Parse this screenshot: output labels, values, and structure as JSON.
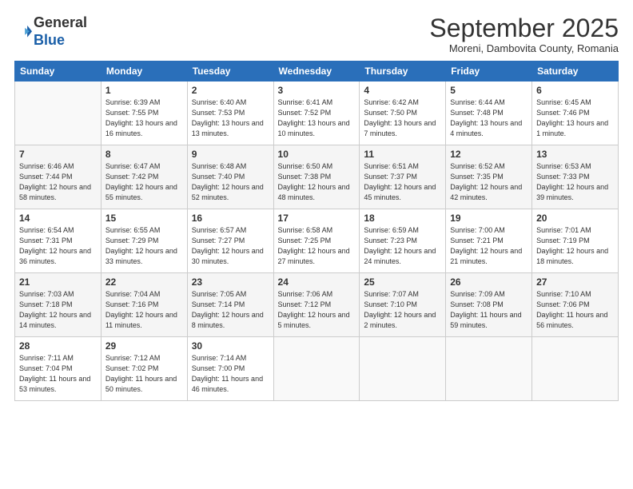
{
  "header": {
    "logo_line1": "General",
    "logo_line2": "Blue",
    "month": "September 2025",
    "location": "Moreni, Dambovita County, Romania"
  },
  "weekdays": [
    "Sunday",
    "Monday",
    "Tuesday",
    "Wednesday",
    "Thursday",
    "Friday",
    "Saturday"
  ],
  "weeks": [
    [
      {
        "day": "",
        "sunrise": "",
        "sunset": "",
        "daylight": ""
      },
      {
        "day": "1",
        "sunrise": "Sunrise: 6:39 AM",
        "sunset": "Sunset: 7:55 PM",
        "daylight": "Daylight: 13 hours and 16 minutes."
      },
      {
        "day": "2",
        "sunrise": "Sunrise: 6:40 AM",
        "sunset": "Sunset: 7:53 PM",
        "daylight": "Daylight: 13 hours and 13 minutes."
      },
      {
        "day": "3",
        "sunrise": "Sunrise: 6:41 AM",
        "sunset": "Sunset: 7:52 PM",
        "daylight": "Daylight: 13 hours and 10 minutes."
      },
      {
        "day": "4",
        "sunrise": "Sunrise: 6:42 AM",
        "sunset": "Sunset: 7:50 PM",
        "daylight": "Daylight: 13 hours and 7 minutes."
      },
      {
        "day": "5",
        "sunrise": "Sunrise: 6:44 AM",
        "sunset": "Sunset: 7:48 PM",
        "daylight": "Daylight: 13 hours and 4 minutes."
      },
      {
        "day": "6",
        "sunrise": "Sunrise: 6:45 AM",
        "sunset": "Sunset: 7:46 PM",
        "daylight": "Daylight: 13 hours and 1 minute."
      }
    ],
    [
      {
        "day": "7",
        "sunrise": "Sunrise: 6:46 AM",
        "sunset": "Sunset: 7:44 PM",
        "daylight": "Daylight: 12 hours and 58 minutes."
      },
      {
        "day": "8",
        "sunrise": "Sunrise: 6:47 AM",
        "sunset": "Sunset: 7:42 PM",
        "daylight": "Daylight: 12 hours and 55 minutes."
      },
      {
        "day": "9",
        "sunrise": "Sunrise: 6:48 AM",
        "sunset": "Sunset: 7:40 PM",
        "daylight": "Daylight: 12 hours and 52 minutes."
      },
      {
        "day": "10",
        "sunrise": "Sunrise: 6:50 AM",
        "sunset": "Sunset: 7:38 PM",
        "daylight": "Daylight: 12 hours and 48 minutes."
      },
      {
        "day": "11",
        "sunrise": "Sunrise: 6:51 AM",
        "sunset": "Sunset: 7:37 PM",
        "daylight": "Daylight: 12 hours and 45 minutes."
      },
      {
        "day": "12",
        "sunrise": "Sunrise: 6:52 AM",
        "sunset": "Sunset: 7:35 PM",
        "daylight": "Daylight: 12 hours and 42 minutes."
      },
      {
        "day": "13",
        "sunrise": "Sunrise: 6:53 AM",
        "sunset": "Sunset: 7:33 PM",
        "daylight": "Daylight: 12 hours and 39 minutes."
      }
    ],
    [
      {
        "day": "14",
        "sunrise": "Sunrise: 6:54 AM",
        "sunset": "Sunset: 7:31 PM",
        "daylight": "Daylight: 12 hours and 36 minutes."
      },
      {
        "day": "15",
        "sunrise": "Sunrise: 6:55 AM",
        "sunset": "Sunset: 7:29 PM",
        "daylight": "Daylight: 12 hours and 33 minutes."
      },
      {
        "day": "16",
        "sunrise": "Sunrise: 6:57 AM",
        "sunset": "Sunset: 7:27 PM",
        "daylight": "Daylight: 12 hours and 30 minutes."
      },
      {
        "day": "17",
        "sunrise": "Sunrise: 6:58 AM",
        "sunset": "Sunset: 7:25 PM",
        "daylight": "Daylight: 12 hours and 27 minutes."
      },
      {
        "day": "18",
        "sunrise": "Sunrise: 6:59 AM",
        "sunset": "Sunset: 7:23 PM",
        "daylight": "Daylight: 12 hours and 24 minutes."
      },
      {
        "day": "19",
        "sunrise": "Sunrise: 7:00 AM",
        "sunset": "Sunset: 7:21 PM",
        "daylight": "Daylight: 12 hours and 21 minutes."
      },
      {
        "day": "20",
        "sunrise": "Sunrise: 7:01 AM",
        "sunset": "Sunset: 7:19 PM",
        "daylight": "Daylight: 12 hours and 18 minutes."
      }
    ],
    [
      {
        "day": "21",
        "sunrise": "Sunrise: 7:03 AM",
        "sunset": "Sunset: 7:18 PM",
        "daylight": "Daylight: 12 hours and 14 minutes."
      },
      {
        "day": "22",
        "sunrise": "Sunrise: 7:04 AM",
        "sunset": "Sunset: 7:16 PM",
        "daylight": "Daylight: 12 hours and 11 minutes."
      },
      {
        "day": "23",
        "sunrise": "Sunrise: 7:05 AM",
        "sunset": "Sunset: 7:14 PM",
        "daylight": "Daylight: 12 hours and 8 minutes."
      },
      {
        "day": "24",
        "sunrise": "Sunrise: 7:06 AM",
        "sunset": "Sunset: 7:12 PM",
        "daylight": "Daylight: 12 hours and 5 minutes."
      },
      {
        "day": "25",
        "sunrise": "Sunrise: 7:07 AM",
        "sunset": "Sunset: 7:10 PM",
        "daylight": "Daylight: 12 hours and 2 minutes."
      },
      {
        "day": "26",
        "sunrise": "Sunrise: 7:09 AM",
        "sunset": "Sunset: 7:08 PM",
        "daylight": "Daylight: 11 hours and 59 minutes."
      },
      {
        "day": "27",
        "sunrise": "Sunrise: 7:10 AM",
        "sunset": "Sunset: 7:06 PM",
        "daylight": "Daylight: 11 hours and 56 minutes."
      }
    ],
    [
      {
        "day": "28",
        "sunrise": "Sunrise: 7:11 AM",
        "sunset": "Sunset: 7:04 PM",
        "daylight": "Daylight: 11 hours and 53 minutes."
      },
      {
        "day": "29",
        "sunrise": "Sunrise: 7:12 AM",
        "sunset": "Sunset: 7:02 PM",
        "daylight": "Daylight: 11 hours and 50 minutes."
      },
      {
        "day": "30",
        "sunrise": "Sunrise: 7:14 AM",
        "sunset": "Sunset: 7:00 PM",
        "daylight": "Daylight: 11 hours and 46 minutes."
      },
      {
        "day": "",
        "sunrise": "",
        "sunset": "",
        "daylight": ""
      },
      {
        "day": "",
        "sunrise": "",
        "sunset": "",
        "daylight": ""
      },
      {
        "day": "",
        "sunrise": "",
        "sunset": "",
        "daylight": ""
      },
      {
        "day": "",
        "sunrise": "",
        "sunset": "",
        "daylight": ""
      }
    ]
  ]
}
